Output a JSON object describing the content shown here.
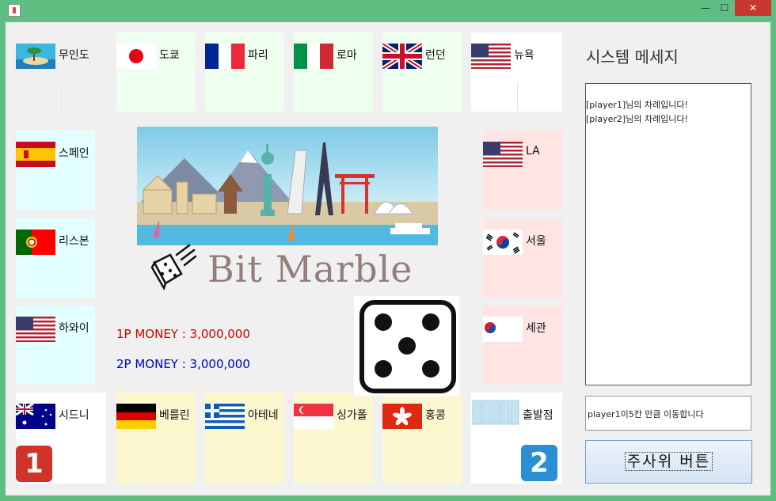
{
  "window": {
    "icon": "java-cup-icon",
    "controls": {
      "minimize": "—",
      "maximize": "☐",
      "close": "✕"
    }
  },
  "board": {
    "top": [
      {
        "label": "무인도",
        "flag": "island-icon",
        "bg": "#ffffff"
      },
      {
        "label": "도쿄",
        "flag": "japan-flag",
        "bg": "#effff0"
      },
      {
        "label": "파리",
        "flag": "france-flag",
        "bg": "#effff0"
      },
      {
        "label": "로마",
        "flag": "italy-flag",
        "bg": "#effff0"
      },
      {
        "label": "런던",
        "flag": "uk-flag",
        "bg": "#effff0"
      },
      {
        "label": "뉴욕",
        "flag": "usa-flag",
        "bg": "#ffffff"
      }
    ],
    "left": [
      {
        "label": "스페인",
        "flag": "spain-flag",
        "bg": "#e3ffff"
      },
      {
        "label": "리스본",
        "flag": "portugal-flag",
        "bg": "#e3ffff"
      },
      {
        "label": "하와이",
        "flag": "usa-flag",
        "bg": "#e3ffff"
      }
    ],
    "right": [
      {
        "label": "LA",
        "flag": "usa-flag",
        "bg": "#ffe4e4"
      },
      {
        "label": "서울",
        "flag": "korea-flag",
        "bg": "#ffe4e4"
      },
      {
        "label": "세관",
        "flag": "nts-logo",
        "bg": "#ffe4e4"
      }
    ],
    "bottom": [
      {
        "label": "시드니",
        "flag": "australia-flag",
        "bg": "#ffffff"
      },
      {
        "label": "베를린",
        "flag": "germany-flag",
        "bg": "#fdf7cf"
      },
      {
        "label": "아테네",
        "flag": "greece-flag",
        "bg": "#fdf7cf"
      },
      {
        "label": "싱가폴",
        "flag": "singapore-flag",
        "bg": "#fdf7cf"
      },
      {
        "label": "홍콩",
        "flag": "hongkong-flag",
        "bg": "#fdf7cf"
      },
      {
        "label": "출발점",
        "flag": "start-icon",
        "bg": "#ffffff"
      }
    ],
    "player1_badge": "1",
    "player2_badge": "2",
    "player1_color": "#d0332a",
    "player2_color": "#2b8fd6"
  },
  "center": {
    "title": "Bit Marble",
    "money1": "1P MONEY : 3,000,000",
    "money2": "2P MONEY : 3,000,000",
    "money1_color": "#d40000",
    "money2_color": "#0000cc",
    "dice_face": 5
  },
  "panel": {
    "title": "시스템 메세지",
    "log": [
      "[player1]님의 차례입니다!",
      "[player2]님의 차례입니다!"
    ],
    "status": "player1이5칸 만큼 이동합니다",
    "dice_button": "주사위 버튼"
  }
}
